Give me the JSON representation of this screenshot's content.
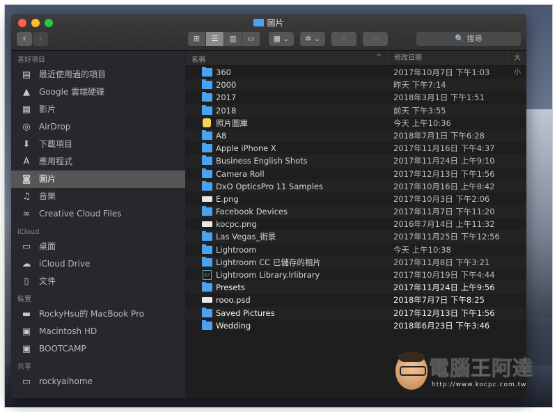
{
  "window": {
    "title": "圖片",
    "nav_back": "‹",
    "nav_forward": "›"
  },
  "toolbar": {
    "view_icons": "⊞",
    "view_list": "☰",
    "view_columns": "▥",
    "view_gallery": "▭",
    "arrange": "▦ ⌄",
    "action": "✲ ⌄",
    "share": "⇪",
    "tag": "▭",
    "search_placeholder": "🔍 搜尋"
  },
  "sidebar": {
    "favorites_header": "喜好項目",
    "favorites": [
      {
        "label": "最近使用過的項目",
        "icon": "recents-icon"
      },
      {
        "label": "Google 雲端硬碟",
        "icon": "google-drive-icon"
      },
      {
        "label": "影片",
        "icon": "movies-icon"
      },
      {
        "label": "AirDrop",
        "icon": "airdrop-icon"
      },
      {
        "label": "下載項目",
        "icon": "downloads-icon"
      },
      {
        "label": "應用程式",
        "icon": "applications-icon"
      },
      {
        "label": "圖片",
        "icon": "camera-icon"
      },
      {
        "label": "音樂",
        "icon": "music-icon"
      },
      {
        "label": "Creative Cloud Files",
        "icon": "creative-cloud-icon"
      }
    ],
    "icloud_header": "iCloud",
    "icloud": [
      {
        "label": "桌面",
        "icon": "desktop-icon"
      },
      {
        "label": "iCloud Drive",
        "icon": "cloud-icon"
      },
      {
        "label": "文件",
        "icon": "documents-icon"
      }
    ],
    "devices_header": "裝置",
    "devices": [
      {
        "label": "RockyHsu的 MacBook Pro",
        "icon": "laptop-icon"
      },
      {
        "label": "Macintosh HD",
        "icon": "disk-icon"
      },
      {
        "label": "BOOTCAMP",
        "icon": "disk-icon"
      }
    ],
    "shared_header": "共享",
    "shared": [
      {
        "label": "rockyaihome",
        "icon": "computer-icon"
      }
    ]
  },
  "list": {
    "col_name": "名稱",
    "col_sort": "^",
    "col_date": "修改日期",
    "col_size": "大小",
    "rows": [
      {
        "name": "360",
        "date": "2017年10月7日 下午1:03",
        "type": "folder",
        "bold": false
      },
      {
        "name": "2000",
        "date": "昨天 下午7:14",
        "type": "folder",
        "bold": false
      },
      {
        "name": "2017",
        "date": "2018年3月1日 下午1:51",
        "type": "folder",
        "bold": false
      },
      {
        "name": "2018",
        "date": "前天 下午3:55",
        "type": "folder",
        "bold": false
      },
      {
        "name": "照片圖庫",
        "date": "今天 上午10:36",
        "type": "photos",
        "bold": false
      },
      {
        "name": "A8",
        "date": "2018年7月1日 下午6:28",
        "type": "folder",
        "bold": false
      },
      {
        "name": "Apple iPhone X",
        "date": "2017年11月16日 下午4:37",
        "type": "folder",
        "bold": false
      },
      {
        "name": "Business English Shots",
        "date": "2017年11月24日 上午9:10",
        "type": "folder",
        "bold": false
      },
      {
        "name": "Camera Roll",
        "date": "2017年12月13日 下午1:56",
        "type": "folder",
        "bold": false
      },
      {
        "name": "DxO OpticsPro 11 Samples",
        "date": "2017年10月16日 上午8:42",
        "type": "folder",
        "bold": false
      },
      {
        "name": "E.png",
        "date": "2017年10月3日 下午2:06",
        "type": "file",
        "bold": false
      },
      {
        "name": "Facebook Devices",
        "date": "2017年11月7日 下午11:20",
        "type": "folder",
        "bold": false
      },
      {
        "name": "kocpc.png",
        "date": "2016年7月14日 上午11:32",
        "type": "file",
        "bold": false
      },
      {
        "name": "Las Vegas_街景",
        "date": "2017年11月25日 下午12:56",
        "type": "folder",
        "bold": false
      },
      {
        "name": "Lightroom",
        "date": "今天 上午10:38",
        "type": "folder",
        "bold": false
      },
      {
        "name": "Lightroom CC 已儲存的相片",
        "date": "2017年11月8日 下午3:21",
        "type": "folder",
        "bold": false
      },
      {
        "name": "Lightroom Library.lrlibrary",
        "date": "2017年10月19日 下午4:44",
        "type": "lib",
        "bold": false
      },
      {
        "name": "Presets",
        "date": "2017年11月24日 上午9:56",
        "type": "folder",
        "bold": true
      },
      {
        "name": "rooo.psd",
        "date": "2018年7月7日 下午8:25",
        "type": "file",
        "bold": true
      },
      {
        "name": "Saved Pictures",
        "date": "2017年12月13日 下午1:56",
        "type": "folder",
        "bold": true
      },
      {
        "name": "Wedding",
        "date": "2018年6月23日 下午3:46",
        "type": "folder",
        "bold": true
      }
    ]
  },
  "watermark": {
    "text": "電腦王阿達",
    "url": "http://www.kocpc.com.tw"
  },
  "colors": {
    "folder": "#4aa3f0",
    "selection": "#555555",
    "window_bg": "#1e1e1e"
  }
}
